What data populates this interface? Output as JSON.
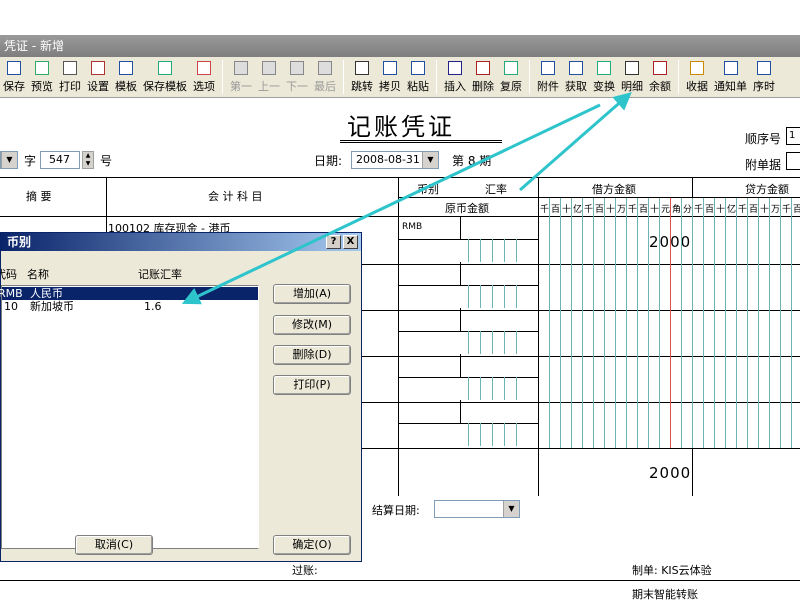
{
  "window": {
    "title": "凭证 - 新增"
  },
  "toolbar": {
    "buttons": [
      {
        "label": "保存",
        "icon": "save-icon",
        "enabled": true
      },
      {
        "label": "预览",
        "icon": "preview-icon",
        "enabled": true
      },
      {
        "label": "打印",
        "icon": "print-icon",
        "enabled": true
      },
      {
        "label": "设置",
        "icon": "settings-icon",
        "enabled": true
      },
      {
        "label": "模板",
        "icon": "template-icon",
        "enabled": true
      },
      {
        "label": "保存模板",
        "icon": "save-template-icon",
        "enabled": true
      },
      {
        "label": "选项",
        "icon": "options-icon",
        "enabled": true
      },
      {
        "label": "第一",
        "icon": "first-icon",
        "enabled": false
      },
      {
        "label": "上一",
        "icon": "prev-icon",
        "enabled": false
      },
      {
        "label": "下一",
        "icon": "next-icon",
        "enabled": false
      },
      {
        "label": "最后",
        "icon": "last-icon",
        "enabled": false
      },
      {
        "label": "跳转",
        "icon": "jump-icon",
        "enabled": true
      },
      {
        "label": "拷贝",
        "icon": "copy-icon",
        "enabled": true
      },
      {
        "label": "粘贴",
        "icon": "paste-icon",
        "enabled": true
      },
      {
        "label": "插入",
        "icon": "insert-icon",
        "enabled": true
      },
      {
        "label": "删除",
        "icon": "delete-icon",
        "enabled": true
      },
      {
        "label": "复原",
        "icon": "restore-icon",
        "enabled": true
      },
      {
        "label": "附件",
        "icon": "attachment-icon",
        "enabled": true
      },
      {
        "label": "获取",
        "icon": "fetch-icon",
        "enabled": true
      },
      {
        "label": "变换",
        "icon": "transform-icon",
        "enabled": true
      },
      {
        "label": "明细",
        "icon": "detail-icon",
        "enabled": true
      },
      {
        "label": "余额",
        "icon": "balance-icon",
        "enabled": true
      },
      {
        "label": "收据",
        "icon": "receipt-icon",
        "enabled": true
      },
      {
        "label": "通知单",
        "icon": "notice-icon",
        "enabled": true
      },
      {
        "label": "序时",
        "icon": "chronological-icon",
        "enabled": true
      }
    ]
  },
  "voucher": {
    "title": "记账凭证",
    "seq_label": "顺序号",
    "seq_value": "1",
    "attach_label": "附单据",
    "word_label": "字",
    "number_value": "547",
    "number_label": "号",
    "date_label": "日期:",
    "date_value": "2008-08-31",
    "period_text": "第 8 期",
    "headers": {
      "summary": "摘    要",
      "account": "会  计  科  目",
      "currency": "币别",
      "rate": "汇率",
      "orig_amount": "原币金额",
      "debit": "借方金额",
      "credit": "贷方金额"
    },
    "units": [
      "千",
      "百",
      "十",
      "亿",
      "千",
      "百",
      "十",
      "万",
      "千",
      "百",
      "十",
      "元",
      "角",
      "分"
    ],
    "row1_account": "100102 库存现金 - 港币",
    "row1_currency": "RMB",
    "row1_debit": "2000",
    "total_debit": "2000",
    "settle_date_label": "结算日期:",
    "post_label": "过账:",
    "maker_label": "制单: KIS云体验",
    "bottom_text": "期末智能转账"
  },
  "dialog": {
    "title": "币别",
    "col_code": "代码",
    "col_name": "名称",
    "col_rate": "记账汇率",
    "rows": [
      {
        "code": "RMB",
        "name": "人民币",
        "rate": "",
        "selected": true
      },
      {
        "code": "10",
        "name": "新加坡币",
        "rate": "1.6",
        "selected": false
      }
    ],
    "add_label": "增加(A)",
    "edit_label": "修改(M)",
    "delete_label": "删除(D)",
    "print_label": "打印(P)",
    "cancel_label": "取消(C)",
    "ok_label": "确定(O)",
    "help_btn": "?",
    "close_btn": "X"
  },
  "colors": {
    "arrow": "#2ec4cc",
    "title_bar": "#0a246a",
    "grid_teal": "#6ab4b4",
    "grid_red": "#e05050"
  }
}
